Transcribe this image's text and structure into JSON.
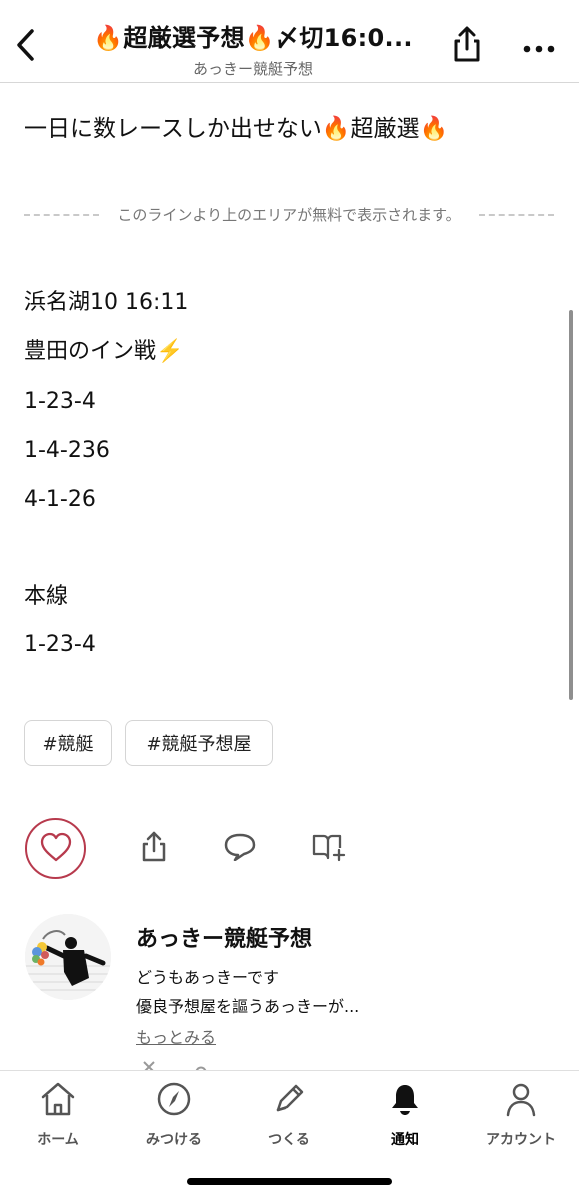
{
  "header": {
    "title": "🔥超厳選予想🔥〆切16:0...",
    "subtitle": "あっきー競艇予想",
    "icons": {
      "back": "chevron-left-icon",
      "share": "share-icon",
      "more": "more-horizontal-icon"
    }
  },
  "article": {
    "lead": "一日に数レースしか出せない🔥超厳選🔥",
    "free_notice": "このラインより上のエリアが無料で表示されます。",
    "lines": [
      "浜名湖10 16:11",
      "豊田のイン戦⚡️",
      "1-23-4",
      "1-4-236",
      "4-1-26",
      "本線",
      "1-23-4"
    ]
  },
  "tags": [
    "#競艇",
    "#競艇予想屋"
  ],
  "actions": {
    "icons": {
      "like": "heart-icon",
      "share": "share-icon",
      "comment": "comment-icon",
      "add_magazine": "magazine-add-icon"
    }
  },
  "creator": {
    "name": "あっきー競艇予想",
    "bio_lines": [
      "どうもあっきーです",
      "優良予想屋を謳うあっきーが..."
    ],
    "more_label": "もっとみる",
    "avatar": "avatar-image"
  },
  "tabbar": {
    "items": [
      {
        "label": "ホーム",
        "icon": "home-icon"
      },
      {
        "label": "みつける",
        "icon": "compass-icon"
      },
      {
        "label": "つくる",
        "icon": "pencil-icon"
      },
      {
        "label": "通知",
        "icon": "bell-icon"
      },
      {
        "label": "アカウント",
        "icon": "user-icon"
      }
    ],
    "active_index": 3
  },
  "colors": {
    "background": "#ffffff",
    "text": "#111111",
    "muted": "#666666",
    "like_accent": "#b73a4d"
  }
}
